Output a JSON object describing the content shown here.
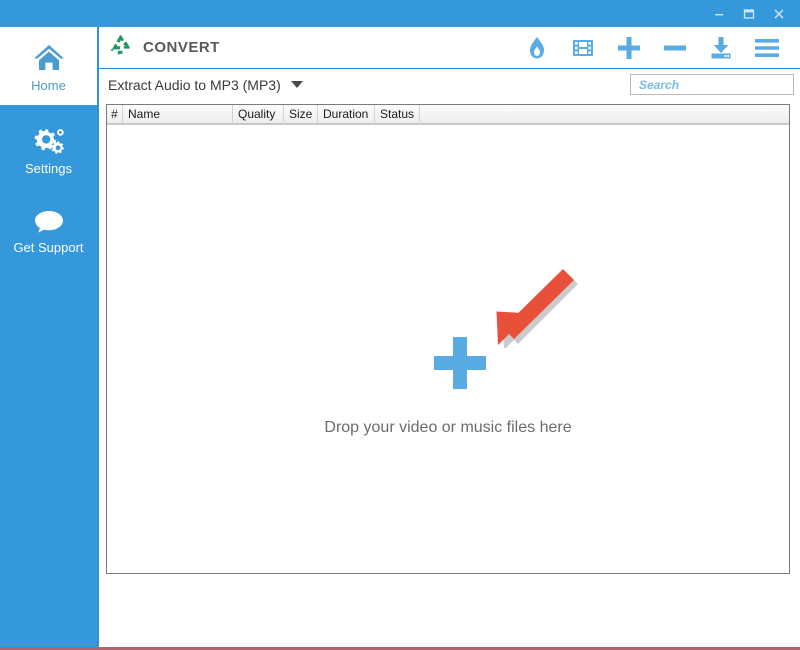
{
  "window": {
    "controls": [
      {
        "name": "minimize",
        "glyph": "minimize-icon"
      },
      {
        "name": "maximize",
        "glyph": "maximize-icon"
      },
      {
        "name": "close",
        "glyph": "close-icon"
      }
    ],
    "titlebar_color": "#3498db"
  },
  "sidebar": {
    "background": "#3498db",
    "active_text_color": "#4a9ad4",
    "items": [
      {
        "label": "Home",
        "icon": "home-icon",
        "active": true
      },
      {
        "label": "Settings",
        "icon": "gears-icon",
        "active": false
      },
      {
        "label": "Get Support",
        "icon": "speech-bubble-icon",
        "active": false
      }
    ]
  },
  "header": {
    "brand": "CONVERT",
    "brand_icon": "recycle-icon",
    "brand_icon_color": "#1f9a60",
    "brand_text_color": "#595959",
    "toolbar": [
      {
        "label": "Burn",
        "icon": "flame-icon"
      },
      {
        "label": "Video",
        "icon": "film-strip-icon"
      },
      {
        "label": "Add",
        "icon": "plus-icon"
      },
      {
        "label": "Remove",
        "icon": "minus-icon"
      },
      {
        "label": "Download",
        "icon": "download-icon"
      },
      {
        "label": "Menu",
        "icon": "hamburger-menu-icon"
      }
    ],
    "toolbar_icon_color": "#5aaae4"
  },
  "subbar": {
    "profile": "Extract Audio to MP3 (MP3)",
    "profile_caret": "chevron-down-icon",
    "search": {
      "placeholder": "Search",
      "value": "",
      "icon": "search-icon"
    }
  },
  "file_list": {
    "columns": [
      "#",
      "Name",
      "Quality",
      "Size",
      "Duration",
      "Status"
    ],
    "rows": [],
    "empty_state": {
      "message": "Drop your video or music files here",
      "plus_icon": "plus-icon",
      "plus_color": "#5aaae4",
      "arrow_icon": "arrow-pointer-icon",
      "arrow_color": "#e8503a"
    }
  }
}
